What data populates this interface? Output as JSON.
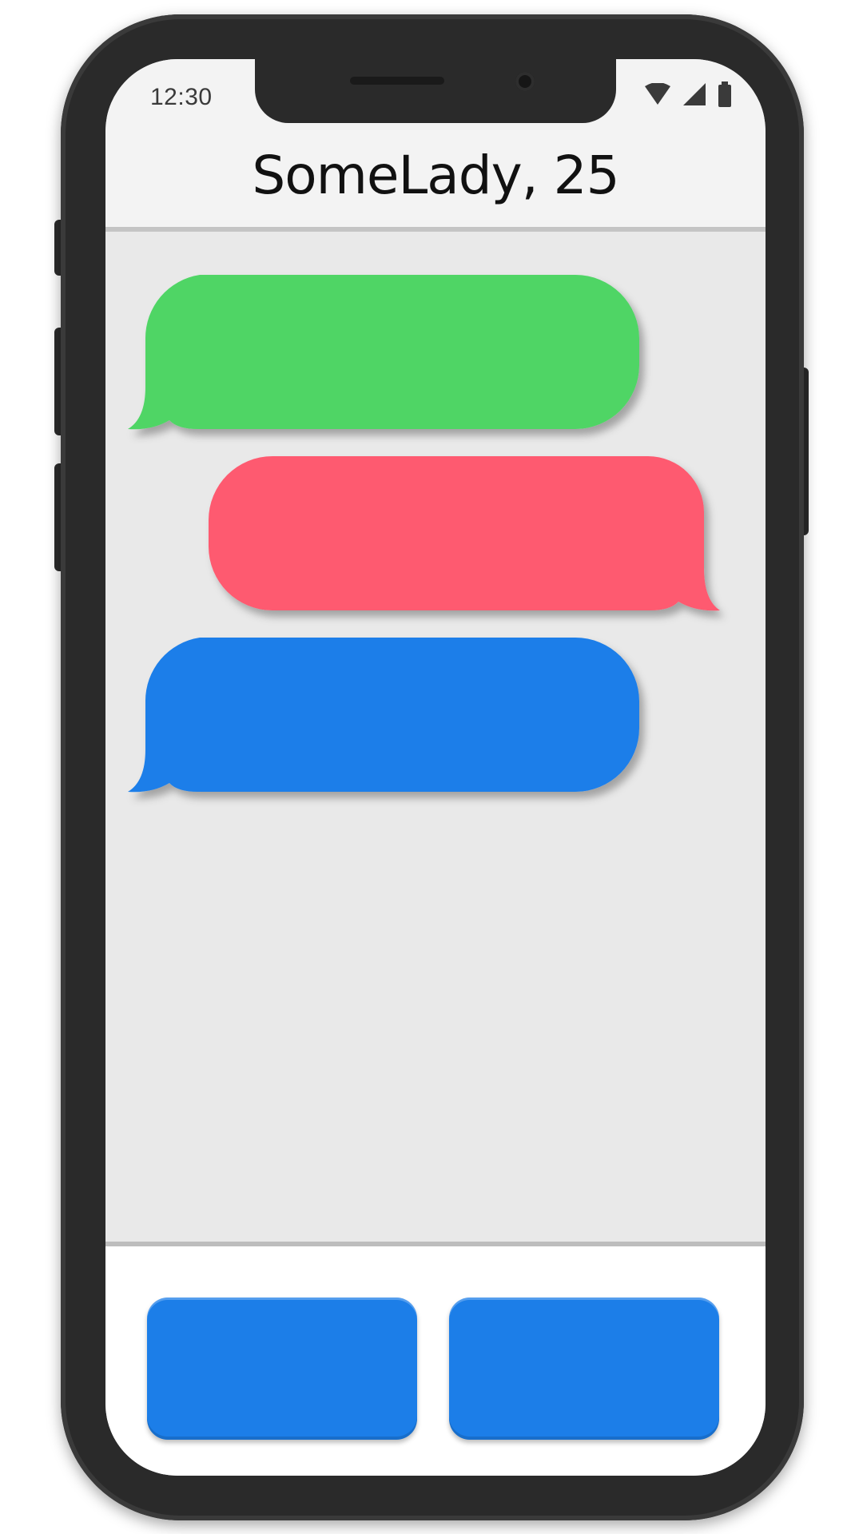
{
  "status_bar": {
    "time": "12:30",
    "icons": [
      "wifi-icon",
      "cellular-signal-icon",
      "battery-icon"
    ]
  },
  "header": {
    "title": "SomeLady, 25"
  },
  "messages": [
    {
      "side": "left",
      "color": "#4fd565"
    },
    {
      "side": "right",
      "color": "#fe5a70"
    },
    {
      "side": "left",
      "color": "#1a7ee9"
    }
  ],
  "actions": [
    {
      "color": "#1c7ee8"
    },
    {
      "color": "#1c7ee8"
    }
  ]
}
